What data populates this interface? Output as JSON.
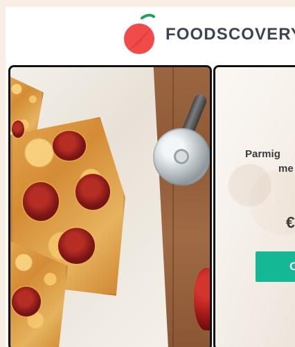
{
  "header": {
    "brand_name": "FOODSCOVERY",
    "logo_icon": "tomato-logo-icon",
    "colors": {
      "logo_red": "#ef4b49",
      "logo_leaf": "#1ea05f",
      "text": "#3e4353"
    }
  },
  "cards": [
    {
      "type": "image",
      "icon": "food-photo"
    },
    {
      "type": "product",
      "title_lines": [
        "Parmig",
        "me"
      ],
      "price": "€",
      "button_label": "C",
      "colors": {
        "button": "#14b894",
        "button_text": "#ffffff"
      }
    }
  ]
}
